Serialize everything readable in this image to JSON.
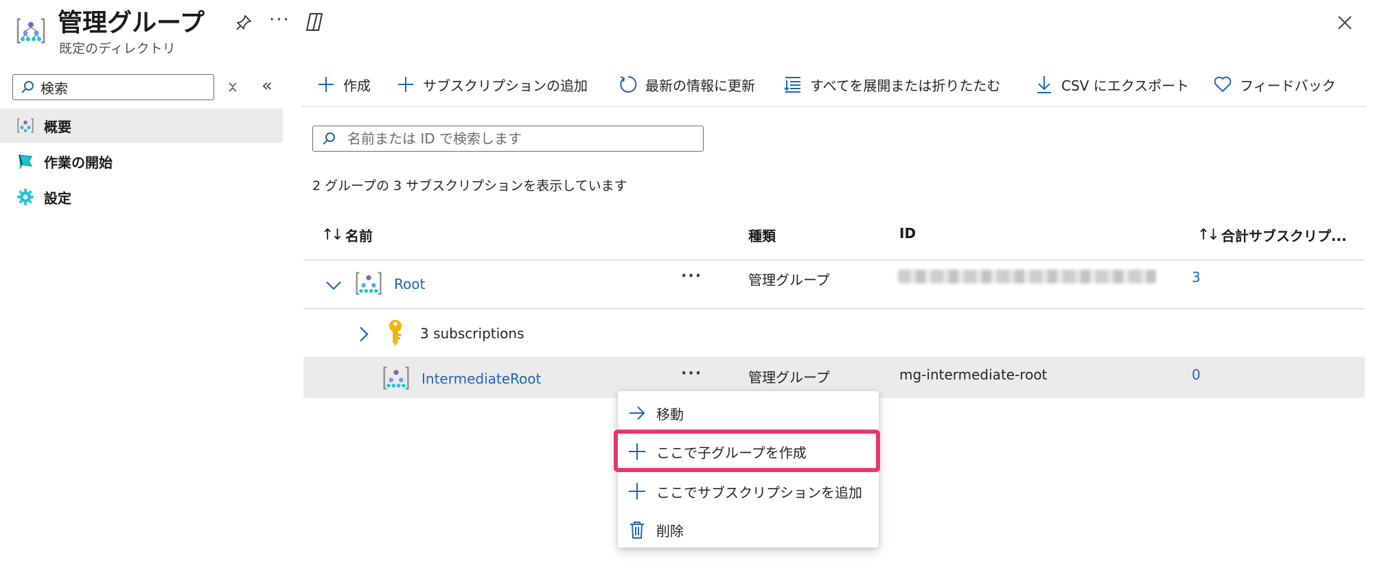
{
  "header": {
    "title": "管理グループ",
    "subtitle": "既定のディレクトリ",
    "more_label": "···"
  },
  "sidebar": {
    "search_value": "検索",
    "items": [
      {
        "label": "概要",
        "icon": "management-group-icon",
        "active": true
      },
      {
        "label": "作業の開始",
        "icon": "quickstart-flag-icon",
        "active": false
      },
      {
        "label": "設定",
        "icon": "settings-gear-icon",
        "active": false
      }
    ]
  },
  "toolbar": {
    "items": [
      {
        "label": "作成",
        "icon": "plus-icon"
      },
      {
        "label": "サブスクリプションの追加",
        "icon": "plus-icon"
      },
      {
        "label": "最新の情報に更新",
        "icon": "refresh-icon"
      },
      {
        "label": "すべてを展開または折りたたむ",
        "icon": "expand-collapse-icon"
      },
      {
        "label": "CSV にエクスポート",
        "icon": "download-icon"
      },
      {
        "label": "フィードバック",
        "icon": "heart-icon"
      }
    ]
  },
  "main": {
    "search_placeholder": "名前または ID で検索します",
    "summary": "2 グループの 3 サブスクリプションを表示しています",
    "columns": {
      "name": "名前",
      "type": "種類",
      "id": "ID",
      "total": "合計サブスクリプ..."
    },
    "rows": [
      {
        "name": "Root",
        "type": "管理グループ",
        "id": "",
        "total": "3",
        "expanded": true
      },
      {
        "name": "3 subscriptions",
        "type": "",
        "id": "",
        "total": "",
        "expanded": false
      },
      {
        "name": "IntermediateRoot",
        "type": "管理グループ",
        "id": "mg-intermediate-root",
        "total": "0",
        "selected": true
      }
    ],
    "row_more_label": "···"
  },
  "context_menu": {
    "items": [
      {
        "label": "移動",
        "icon": "arrow-right-icon"
      },
      {
        "label": "ここで子グループを作成",
        "icon": "plus-icon",
        "highlighted": true
      },
      {
        "label": "ここでサブスクリプションを追加",
        "icon": "plus-icon"
      },
      {
        "label": "削除",
        "icon": "trash-icon"
      }
    ]
  },
  "colors": {
    "accent": "#1d63b6",
    "highlight_border": "#ec3470",
    "selected_row": "#ebebeb",
    "key_icon": "#f2b600"
  }
}
